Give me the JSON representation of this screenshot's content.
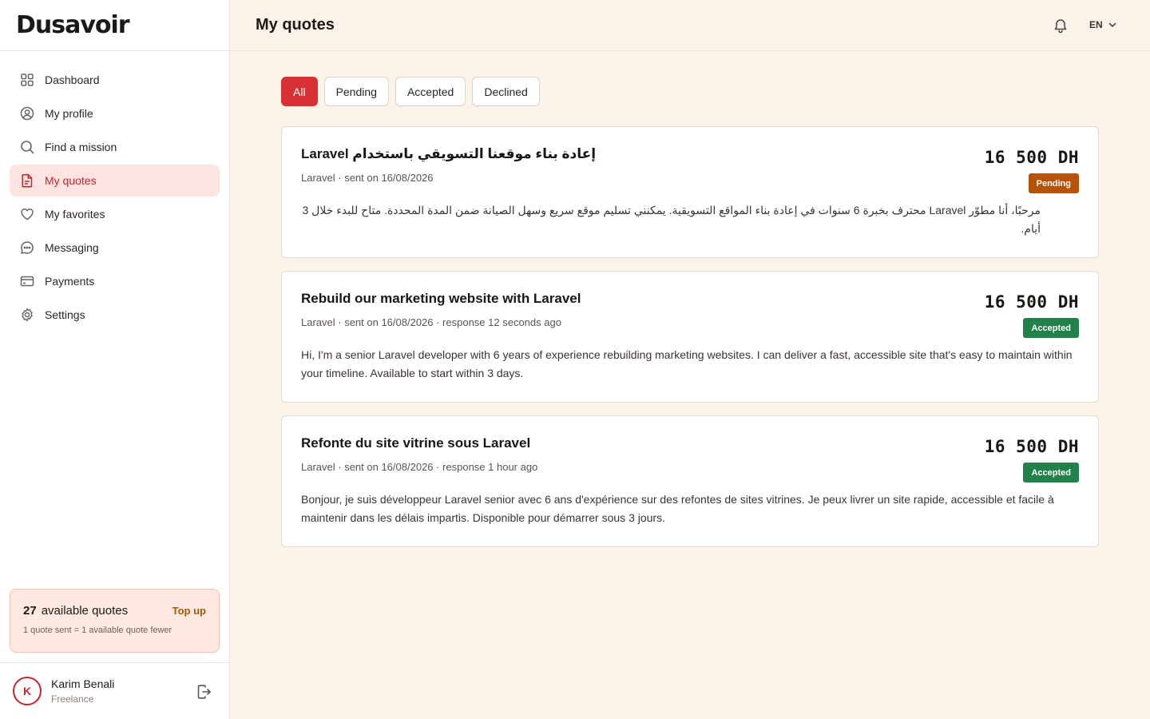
{
  "brand": {
    "logo": "Dusavoir"
  },
  "sidebar": {
    "items": [
      {
        "label": "Dashboard",
        "icon": "grid-icon",
        "active": false
      },
      {
        "label": "My profile",
        "icon": "user-circle-icon",
        "active": false
      },
      {
        "label": "Find a mission",
        "icon": "search-icon",
        "active": false
      },
      {
        "label": "My quotes",
        "icon": "document-icon",
        "active": true
      },
      {
        "label": "My favorites",
        "icon": "heart-icon",
        "active": false
      },
      {
        "label": "Messaging",
        "icon": "chat-icon",
        "active": false
      },
      {
        "label": "Payments",
        "icon": "credit-card-icon",
        "active": false
      },
      {
        "label": "Settings",
        "icon": "gear-icon",
        "active": false
      }
    ],
    "credits": {
      "count": "27",
      "label": "available quotes",
      "topup_label": "Top up",
      "note": "1 quote sent = 1 available quote fewer"
    },
    "user": {
      "initial": "K",
      "name": "Karim Benali",
      "role": "Freelance"
    }
  },
  "header": {
    "title": "My quotes",
    "language": "EN"
  },
  "filters": [
    {
      "label": "All",
      "active": true
    },
    {
      "label": "Pending",
      "active": false
    },
    {
      "label": "Accepted",
      "active": false
    },
    {
      "label": "Declined",
      "active": false
    }
  ],
  "quotes": [
    {
      "title": "إعادة بناء موقعنا التسويقي باستخدام Laravel",
      "meta": "Laravel · sent on 16/08/2026",
      "price": "16 500 DH",
      "status": "Pending",
      "text": "مرحبًا، أنا مطوّر Laravel محترف بخبرة 6 سنوات في إعادة بناء المواقع التسويقية. يمكنني تسليم موقع سريع وسهل الصيانة ضمن المدة المحددة. متاح للبدء خلال 3 أيام."
    },
    {
      "title": "Rebuild our marketing website with Laravel",
      "meta": "Laravel · sent on 16/08/2026 · response 12 seconds ago",
      "price": "16 500 DH",
      "status": "Accepted",
      "text": "Hi, I'm a senior Laravel developer with 6 years of experience rebuilding marketing websites. I can deliver a fast, accessible site that's easy to maintain within your timeline. Available to start within 3 days."
    },
    {
      "title": "Refonte du site vitrine sous Laravel",
      "meta": "Laravel · sent on 16/08/2026 · response 1 hour ago",
      "price": "16 500 DH",
      "status": "Accepted",
      "text": "Bonjour, je suis développeur Laravel senior avec 6 ans d'expérience sur des refontes de sites vitrines. Je peux livrer un site rapide, accessible et facile à maintenir dans les délais impartis. Disponible pour démarrer sous 3 jours."
    }
  ],
  "colors": {
    "accent": "#d63236",
    "pending": "#b45309",
    "accepted": "#22804a",
    "background": "#fbf3ea"
  }
}
